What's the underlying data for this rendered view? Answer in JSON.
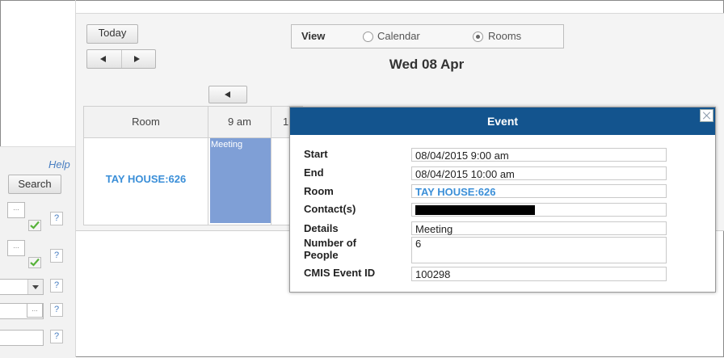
{
  "left_panel": {
    "help_label": "Help",
    "search_label": "Search",
    "picker_glyph": "...",
    "help_glyph": "?"
  },
  "toolbar": {
    "today_label": "Today",
    "view_label": "View",
    "view_options": [
      {
        "label": "Calendar",
        "selected": false
      },
      {
        "label": "Rooms",
        "selected": true
      }
    ],
    "date_title": "Wed 08 Apr"
  },
  "grid": {
    "headers": [
      "Room",
      "9 am",
      "1"
    ],
    "rooms": [
      {
        "name": "TAY HOUSE:626",
        "events": [
          {
            "label": "Meeting",
            "color": "#7f9fd6"
          }
        ]
      }
    ]
  },
  "dialog": {
    "title": "Event",
    "title_bg": "#13548e",
    "fields": {
      "start": {
        "label": "Start",
        "value": "08/04/2015 9:00 am"
      },
      "end": {
        "label": "End",
        "value": "08/04/2015 10:00 am"
      },
      "room": {
        "label": "Room",
        "value": "TAY HOUSE:626"
      },
      "contacts": {
        "label": "Contact(s)",
        "value": ""
      },
      "details": {
        "label": "Details",
        "value": "Meeting"
      },
      "people": {
        "label_line1": "Number of",
        "label_line2": "People",
        "value": "6"
      },
      "cmis": {
        "label": "CMIS Event ID",
        "value": "100298"
      }
    }
  }
}
